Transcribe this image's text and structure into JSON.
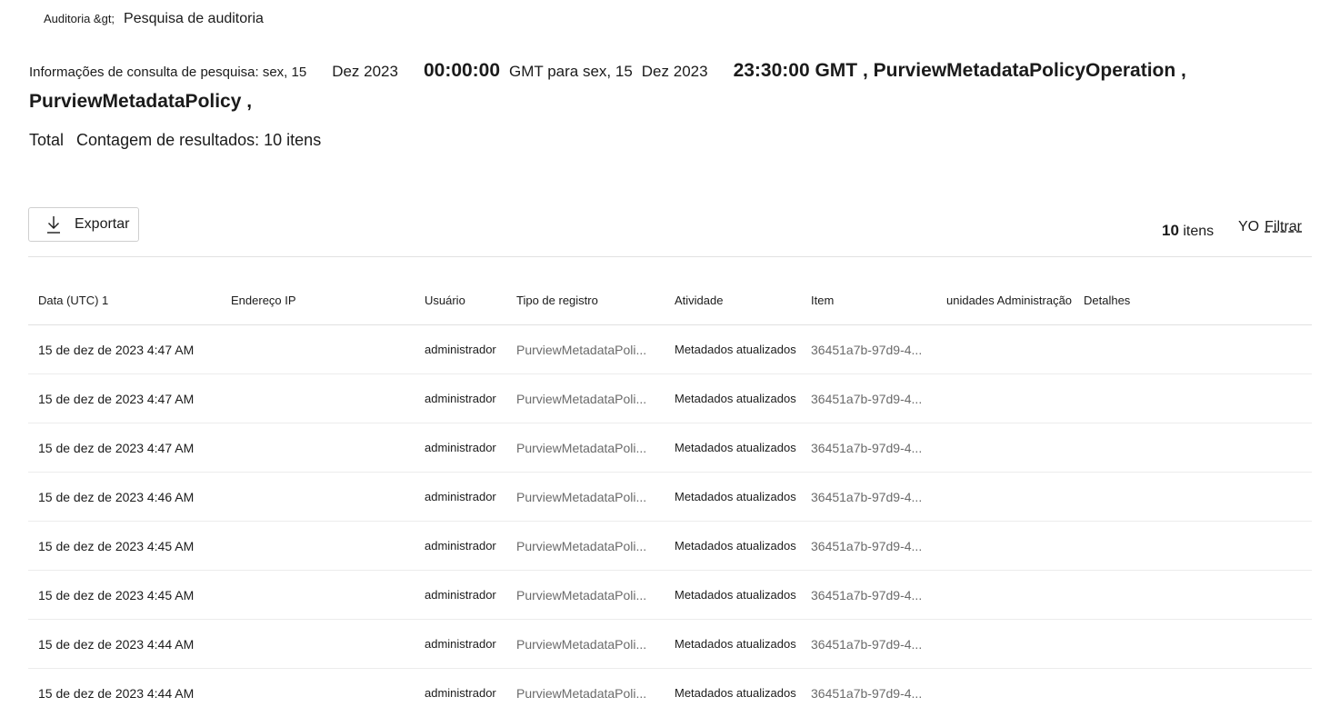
{
  "breadcrumb": {
    "parent": "Auditoria &gt;",
    "current": "Pesquisa de auditoria"
  },
  "query_info": {
    "label": "Informações de consulta de pesquisa: sex, 15",
    "date_start": "Dez 2023",
    "time_start": "00:00:00",
    "gmt_to": "GMT para sex, 15",
    "date_end": "Dez 2023",
    "time_end": "23:30:00 GMT , PurviewMetadataPolicyOperation ,",
    "line2": "PurviewMetadataPolicy ,"
  },
  "total": {
    "label": "Total",
    "text": "Contagem de resultados: 10 itens"
  },
  "toolbar": {
    "export_label": "Exportar",
    "items_count": "10",
    "items_suffix": "itens",
    "filter_icon_text": "YO",
    "filter_label": "Filtrar"
  },
  "table": {
    "headers": [
      "Data (UTC) 1",
      "Endereço IP",
      "Usuário",
      "Tipo de registro",
      "Atividade",
      "Item",
      "unidades Administração",
      "Detalhes"
    ],
    "rows": [
      {
        "date": "15 de dez de 2023 4:47 AM",
        "ip": "",
        "user": "administrador",
        "type": "PurviewMetadataPoli...",
        "activity": "Metadados atualizados",
        "item": "36451a7b-97d9-4...",
        "admin": "",
        "details": ""
      },
      {
        "date": "15 de dez de 2023 4:47 AM",
        "ip": "",
        "user": "administrador",
        "type": "PurviewMetadataPoli...",
        "activity": "Metadados atualizados",
        "item": "36451a7b-97d9-4...",
        "admin": "",
        "details": ""
      },
      {
        "date": "15 de dez de 2023 4:47 AM",
        "ip": "",
        "user": "administrador",
        "type": "PurviewMetadataPoli...",
        "activity": "Metadados atualizados",
        "item": "36451a7b-97d9-4...",
        "admin": "",
        "details": ""
      },
      {
        "date": "15 de dez de 2023 4:46 AM",
        "ip": "",
        "user": "administrador",
        "type": "PurviewMetadataPoli...",
        "activity": "Metadados atualizados",
        "item": "36451a7b-97d9-4...",
        "admin": "",
        "details": ""
      },
      {
        "date": "15 de dez de 2023 4:45 AM",
        "ip": "",
        "user": "administrador",
        "type": "PurviewMetadataPoli...",
        "activity": "Metadados atualizados",
        "item": "36451a7b-97d9-4...",
        "admin": "",
        "details": ""
      },
      {
        "date": "15 de dez de 2023 4:45 AM",
        "ip": "",
        "user": "administrador",
        "type": "PurviewMetadataPoli...",
        "activity": "Metadados atualizados",
        "item": "36451a7b-97d9-4...",
        "admin": "",
        "details": ""
      },
      {
        "date": "15 de dez de 2023 4:44 AM",
        "ip": "",
        "user": "administrador",
        "type": "PurviewMetadataPoli...",
        "activity": "Metadados atualizados",
        "item": "36451a7b-97d9-4...",
        "admin": "",
        "details": ""
      },
      {
        "date": "15 de dez de 2023 4:44 AM",
        "ip": "",
        "user": "administrador",
        "type": "PurviewMetadataPoli...",
        "activity": "Metadados atualizados",
        "item": "36451a7b-97d9-4...",
        "admin": "",
        "details": ""
      }
    ]
  }
}
